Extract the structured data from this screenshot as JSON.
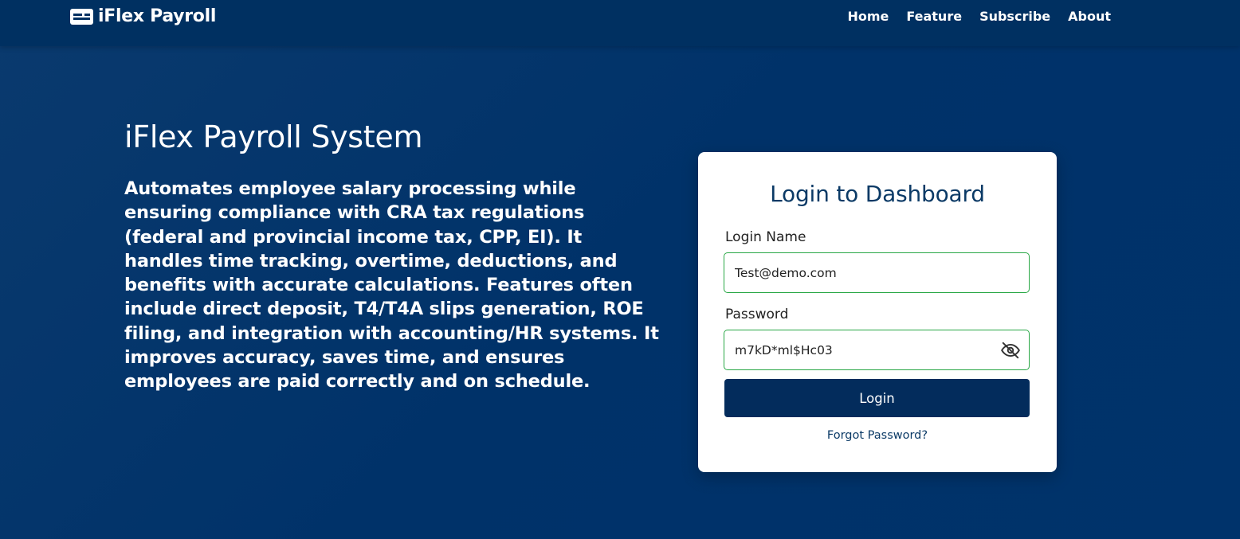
{
  "brand": {
    "name": "iFlex Payroll",
    "icon": "id-card-icon"
  },
  "nav": {
    "items": [
      {
        "label": "Home"
      },
      {
        "label": "Feature"
      },
      {
        "label": "Subscribe"
      },
      {
        "label": "About"
      }
    ]
  },
  "hero": {
    "title": "iFlex Payroll System",
    "description": "Automates employee salary processing while ensuring compliance with CRA tax regulations (federal and provincial income tax, CPP, EI). It handles time tracking, overtime, deductions, and benefits with accurate calculations. Features often include direct deposit, T4/T4A slips generation, ROE filing, and integration with accounting/HR systems. It improves accuracy, saves time, and ensures employees are paid correctly and on schedule."
  },
  "login": {
    "title": "Login to Dashboard",
    "login_name_label": "Login Name",
    "login_name_value": "Test@demo.com",
    "password_label": "Password",
    "password_value": "m7kD*ml$Hc03",
    "password_toggle_icon": "eye-slash-icon",
    "submit_label": "Login",
    "forgot_label": "Forgot Password?"
  },
  "colors": {
    "background": "#003269",
    "navbar": "#003061",
    "card": "#ffffff",
    "accent": "#0b3a66",
    "button": "#032c5c",
    "input_border": "#28a745"
  }
}
